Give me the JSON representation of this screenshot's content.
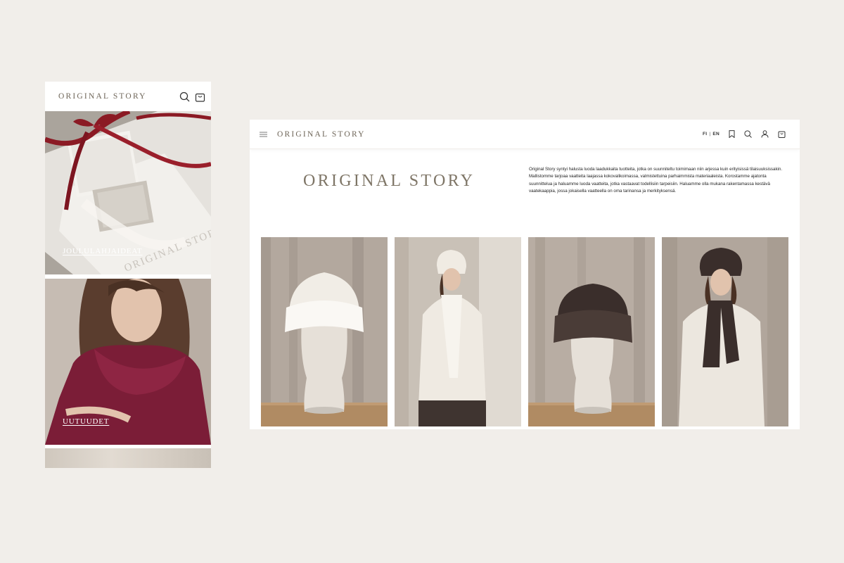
{
  "mobile": {
    "logo": "ORIGINAL STORY",
    "icons": [
      "search-icon",
      "cart-icon"
    ],
    "tiles": [
      {
        "label": "JOULULAHJAIDEAT",
        "image": "gift-box-with-red-ribbon"
      },
      {
        "label": "UUTUUDET",
        "image": "woman-in-burgundy-knit"
      },
      {
        "label": "",
        "image": "partial-tile"
      }
    ],
    "watermark": "ORIGINAL STORY"
  },
  "desktop": {
    "menu_icon": "hamburger-icon",
    "logo": "ORIGINAL STORY",
    "lang": {
      "fi": "FI",
      "en": "EN"
    },
    "icons": [
      "bookmark-icon",
      "search-icon",
      "user-icon",
      "cart-icon"
    ],
    "hero": {
      "title": "ORIGINAL STORY",
      "text": "Original Story syntyi halusta luoda laadukkaita tuotteita, jotka on suunniteltu toimimaan niin arjessa kuin erityisissä tilaisuuksissakin. Mallistomme tarjoaa vaatteita laajassa kokovalikoimassa, valmistettuina parhaimmista materiaaleista. Korostamme ajatonta suunnittelua ja haluamme luoda vaatteita, jotka vastaavat todellisiin tarpeisiin. Haluamme olla mukana rakentamassa kestävä vaatekaappia, jossa jokaisella vaatteella on oma tarinansa ja merkityksensä."
    },
    "products": [
      {
        "name": "cream-beanie-on-mannequin"
      },
      {
        "name": "woman-in-cream-beanie-and-scarf"
      },
      {
        "name": "brown-beanie-on-mannequin"
      },
      {
        "name": "woman-in-brown-beanie-and-scarf"
      }
    ]
  },
  "colors": {
    "page_bg": "#f1eeea",
    "logo": "#6e6558",
    "hero_title": "#7e7566",
    "ribbon": "#8b1a24",
    "burgundy": "#7b1d37",
    "cream": "#efebe4",
    "dark_brown": "#3a2e2b"
  }
}
